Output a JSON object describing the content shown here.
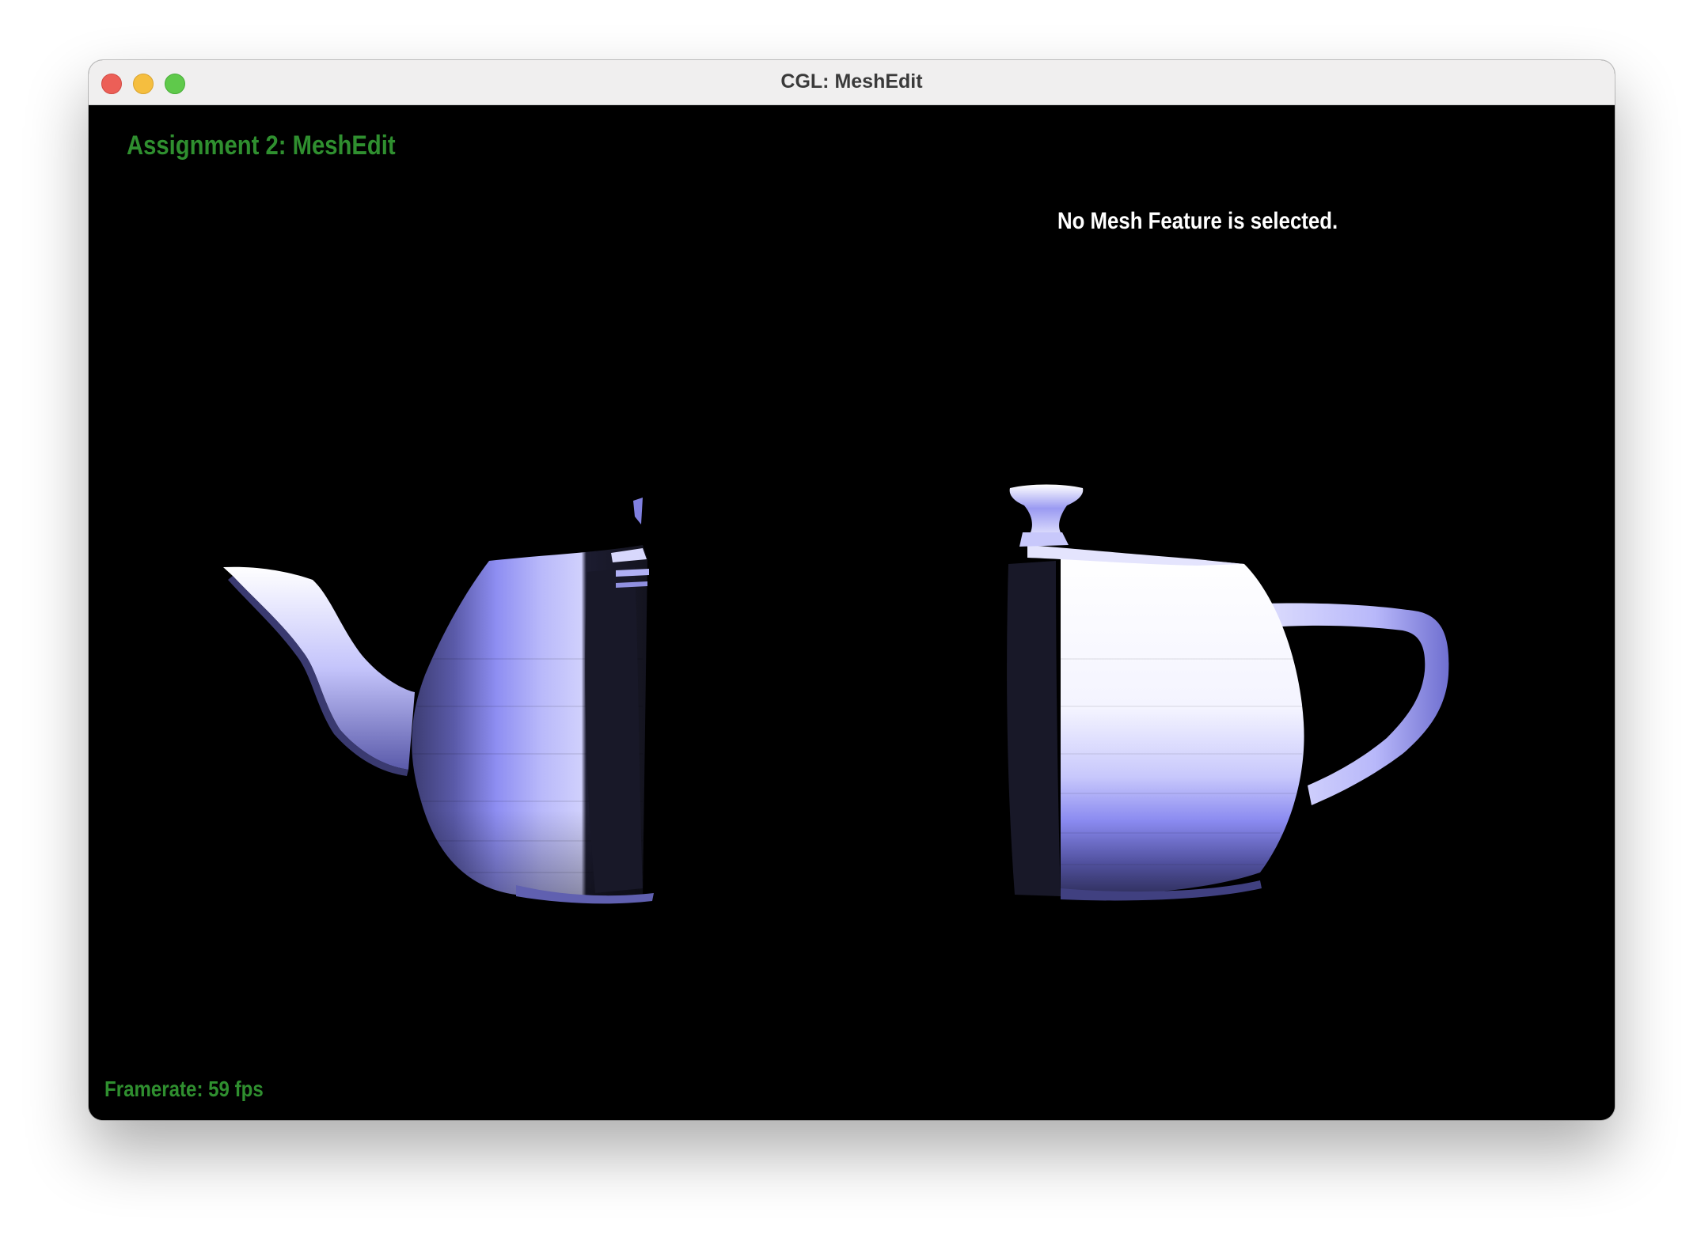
{
  "window": {
    "title": "CGL: MeshEdit"
  },
  "overlay": {
    "app_title": "Assignment 2: MeshEdit",
    "selection_status": "No Mesh Feature is selected.",
    "framerate_label": "Framerate:",
    "framerate_value": "59 fps"
  },
  "colors": {
    "overlay_green": "#2f8f2f",
    "mesh_light": "#ffffff",
    "mesh_mid": "#8c8cf0",
    "mesh_dark": "#1a1a2e",
    "background": "#000000"
  },
  "scene": {
    "left_piece": "teapot-half-with-spout",
    "right_piece": "teapot-half-with-handle-and-lid"
  }
}
